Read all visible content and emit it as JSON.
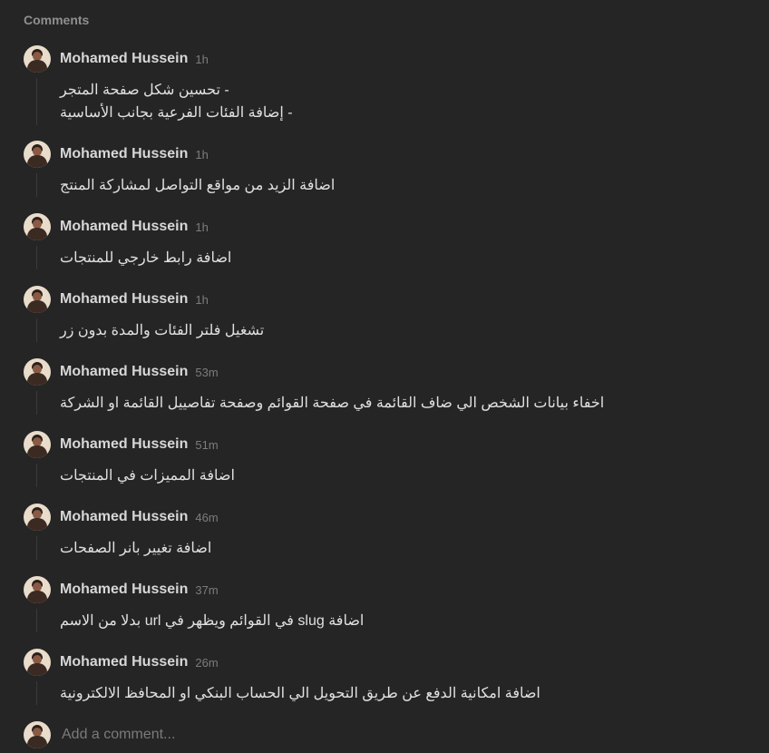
{
  "header": {
    "title": "Comments"
  },
  "comments": [
    {
      "author": "Mohamed Hussein",
      "time": "1h",
      "lines": [
        "- تحسين شكل صفحة المتجر",
        "- إضافة الفئات الفرعية بجانب الأساسية"
      ]
    },
    {
      "author": "Mohamed Hussein",
      "time": "1h",
      "lines": [
        "اضافة الزيد من مواقع التواصل لمشاركة المنتج"
      ]
    },
    {
      "author": "Mohamed Hussein",
      "time": "1h",
      "lines": [
        "اضافة رابط خارجي للمنتجات"
      ]
    },
    {
      "author": "Mohamed Hussein",
      "time": "1h",
      "lines": [
        "تشغيل فلتر الفئات والمدة بدون زر"
      ]
    },
    {
      "author": "Mohamed Hussein",
      "time": "53m",
      "lines": [
        "اخفاء بيانات الشخص الي ضاف القائمة في صفحة القوائم وصفحة تفاصييل القائمة او الشركة"
      ]
    },
    {
      "author": "Mohamed Hussein",
      "time": "51m",
      "lines": [
        "اضافة المميزات في المنتجات"
      ]
    },
    {
      "author": "Mohamed Hussein",
      "time": "46m",
      "lines": [
        "اضافة تغيير بانر الصفحات"
      ]
    },
    {
      "author": "Mohamed Hussein",
      "time": "37m",
      "lines": [
        "اضافة slug في القوائم ويظهر في url بدلا من الاسم"
      ]
    },
    {
      "author": "Mohamed Hussein",
      "time": "26m",
      "lines": [
        "اضافة امكانية الدفع عن طريق التحويل الي الحساب البنكي او المحافظ الالكترونية"
      ]
    }
  ],
  "add_comment": {
    "placeholder": "Add a comment..."
  },
  "icons": {
    "avatar": "user-avatar-icon"
  },
  "colors": {
    "background": "#252525",
    "author": "#d7d7d7",
    "timestamp": "#7c7c7c",
    "header": "#8f8f8f"
  }
}
